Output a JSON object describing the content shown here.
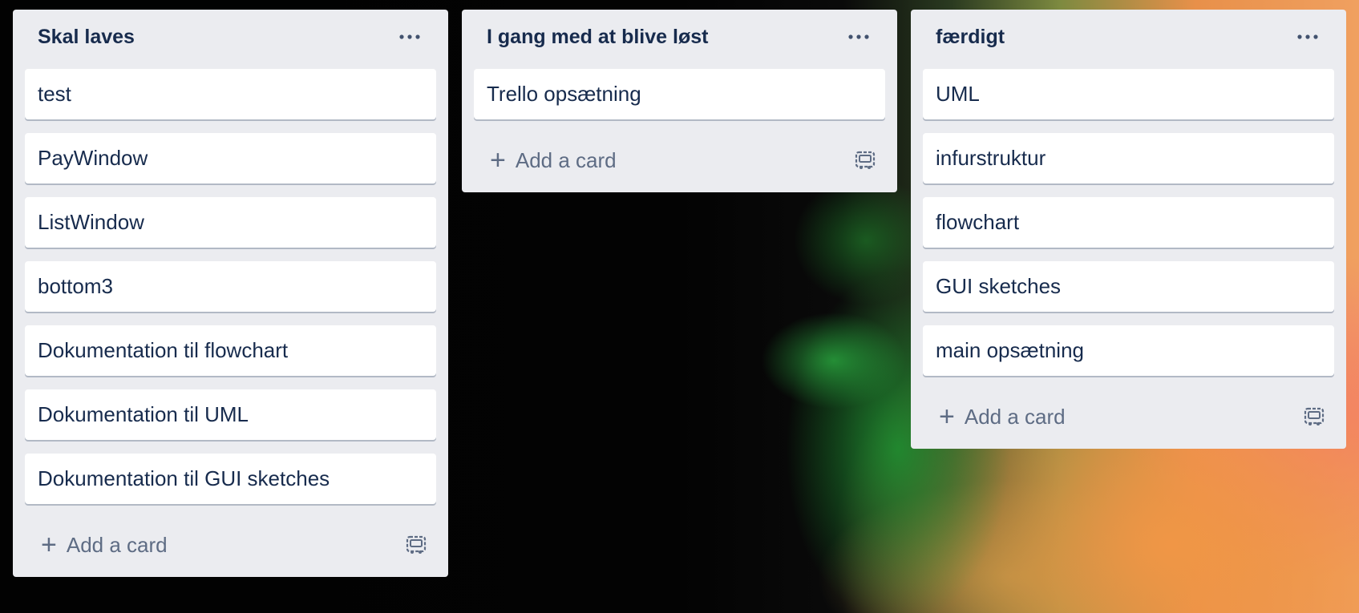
{
  "board": {
    "lists": [
      {
        "title": "Skal laves",
        "cards": [
          "test",
          "PayWindow",
          "ListWindow",
          "bottom3",
          "Dokumentation til flowchart",
          "Dokumentation til UML",
          "Dokumentation til GUI sketches"
        ],
        "add_label": "Add a card"
      },
      {
        "title": "I gang med at blive løst",
        "cards": [
          "Trello opsætning"
        ],
        "add_label": "Add a card"
      },
      {
        "title": "færdigt",
        "cards": [
          "UML",
          "infurstruktur",
          "flowchart",
          "GUI sketches",
          "main opsætning"
        ],
        "add_label": "Add a card"
      }
    ]
  },
  "icons": {
    "list_menu": "ellipsis-icon",
    "add": "plus-icon",
    "template": "card-template-icon"
  },
  "colors": {
    "list_bg": "#ebecf0",
    "card_bg": "#ffffff",
    "title_text": "#172b4d",
    "muted_text": "#5e6c84"
  }
}
